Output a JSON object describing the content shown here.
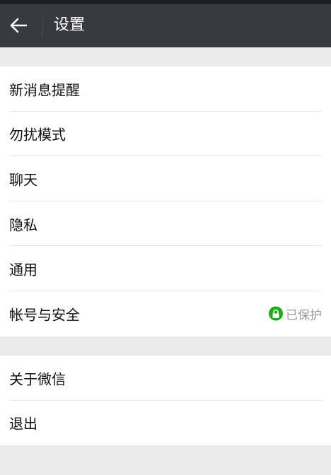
{
  "header": {
    "title": "设置"
  },
  "group1": [
    {
      "label": "新消息提醒"
    },
    {
      "label": "勿扰模式"
    },
    {
      "label": "聊天"
    },
    {
      "label": "隐私"
    },
    {
      "label": "通用"
    },
    {
      "label": "帐号与安全",
      "status": "已保护"
    }
  ],
  "group2": [
    {
      "label": "关于微信"
    },
    {
      "label": "退出"
    }
  ],
  "colors": {
    "titlebar": "#393a3f",
    "accent": "#1aad19",
    "background": "#ebebeb"
  },
  "icons": {
    "back": "arrow-left-icon",
    "lock": "lock-icon"
  }
}
